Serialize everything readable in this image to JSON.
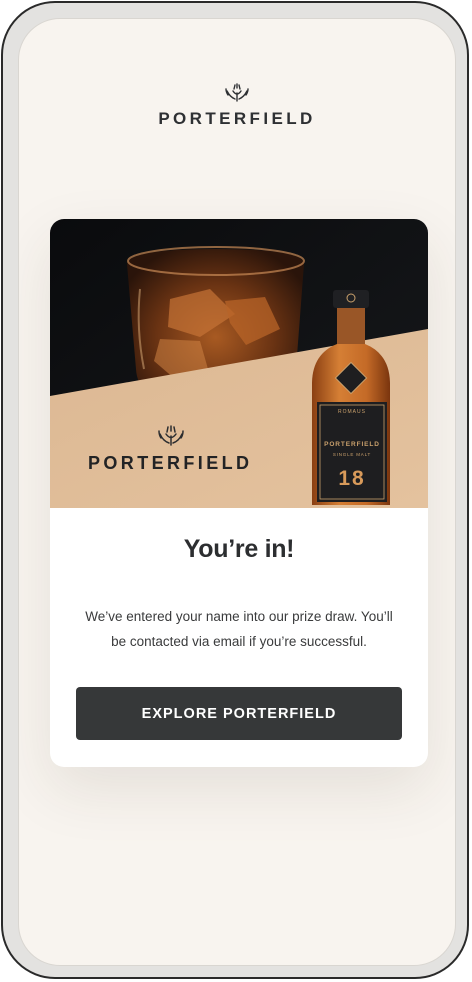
{
  "brand": {
    "name": "PORTERFIELD",
    "logo_icon": "thistle-icon"
  },
  "hero": {
    "brand_name": "PORTERFIELD",
    "bottle": {
      "top_line": "ROMAUS",
      "name": "PORTERFIELD",
      "subline": "SINGLE MALT",
      "age": "18"
    }
  },
  "card": {
    "title": "You’re in!",
    "body": "We’ve entered your name into our prize draw. You’ll be contacted via email if you’re successful.",
    "cta_label": "EXPLORE PORTERFIELD"
  },
  "colors": {
    "screen_bg": "#f8f4ef",
    "button_bg": "#363839",
    "hero_tan": "#ddb994",
    "hero_dark": "#0d0e10",
    "text_dark": "#2e3033"
  }
}
